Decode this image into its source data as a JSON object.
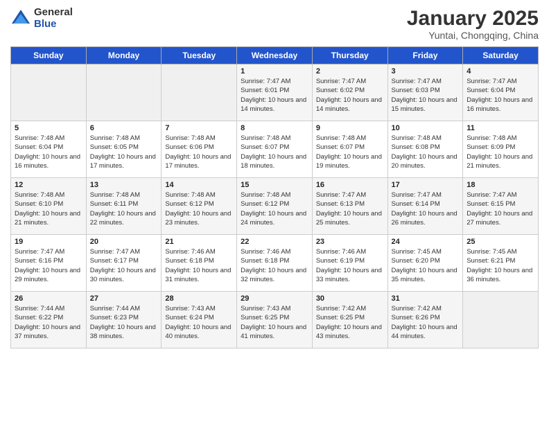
{
  "logo": {
    "general": "General",
    "blue": "Blue"
  },
  "title": "January 2025",
  "subtitle": "Yuntai, Chongqing, China",
  "days_of_week": [
    "Sunday",
    "Monday",
    "Tuesday",
    "Wednesday",
    "Thursday",
    "Friday",
    "Saturday"
  ],
  "weeks": [
    [
      {
        "day": "",
        "info": ""
      },
      {
        "day": "",
        "info": ""
      },
      {
        "day": "",
        "info": ""
      },
      {
        "day": "1",
        "info": "Sunrise: 7:47 AM\nSunset: 6:01 PM\nDaylight: 10 hours and 14 minutes."
      },
      {
        "day": "2",
        "info": "Sunrise: 7:47 AM\nSunset: 6:02 PM\nDaylight: 10 hours and 14 minutes."
      },
      {
        "day": "3",
        "info": "Sunrise: 7:47 AM\nSunset: 6:03 PM\nDaylight: 10 hours and 15 minutes."
      },
      {
        "day": "4",
        "info": "Sunrise: 7:47 AM\nSunset: 6:04 PM\nDaylight: 10 hours and 16 minutes."
      }
    ],
    [
      {
        "day": "5",
        "info": "Sunrise: 7:48 AM\nSunset: 6:04 PM\nDaylight: 10 hours and 16 minutes."
      },
      {
        "day": "6",
        "info": "Sunrise: 7:48 AM\nSunset: 6:05 PM\nDaylight: 10 hours and 17 minutes."
      },
      {
        "day": "7",
        "info": "Sunrise: 7:48 AM\nSunset: 6:06 PM\nDaylight: 10 hours and 17 minutes."
      },
      {
        "day": "8",
        "info": "Sunrise: 7:48 AM\nSunset: 6:07 PM\nDaylight: 10 hours and 18 minutes."
      },
      {
        "day": "9",
        "info": "Sunrise: 7:48 AM\nSunset: 6:07 PM\nDaylight: 10 hours and 19 minutes."
      },
      {
        "day": "10",
        "info": "Sunrise: 7:48 AM\nSunset: 6:08 PM\nDaylight: 10 hours and 20 minutes."
      },
      {
        "day": "11",
        "info": "Sunrise: 7:48 AM\nSunset: 6:09 PM\nDaylight: 10 hours and 21 minutes."
      }
    ],
    [
      {
        "day": "12",
        "info": "Sunrise: 7:48 AM\nSunset: 6:10 PM\nDaylight: 10 hours and 21 minutes."
      },
      {
        "day": "13",
        "info": "Sunrise: 7:48 AM\nSunset: 6:11 PM\nDaylight: 10 hours and 22 minutes."
      },
      {
        "day": "14",
        "info": "Sunrise: 7:48 AM\nSunset: 6:12 PM\nDaylight: 10 hours and 23 minutes."
      },
      {
        "day": "15",
        "info": "Sunrise: 7:48 AM\nSunset: 6:12 PM\nDaylight: 10 hours and 24 minutes."
      },
      {
        "day": "16",
        "info": "Sunrise: 7:47 AM\nSunset: 6:13 PM\nDaylight: 10 hours and 25 minutes."
      },
      {
        "day": "17",
        "info": "Sunrise: 7:47 AM\nSunset: 6:14 PM\nDaylight: 10 hours and 26 minutes."
      },
      {
        "day": "18",
        "info": "Sunrise: 7:47 AM\nSunset: 6:15 PM\nDaylight: 10 hours and 27 minutes."
      }
    ],
    [
      {
        "day": "19",
        "info": "Sunrise: 7:47 AM\nSunset: 6:16 PM\nDaylight: 10 hours and 29 minutes."
      },
      {
        "day": "20",
        "info": "Sunrise: 7:47 AM\nSunset: 6:17 PM\nDaylight: 10 hours and 30 minutes."
      },
      {
        "day": "21",
        "info": "Sunrise: 7:46 AM\nSunset: 6:18 PM\nDaylight: 10 hours and 31 minutes."
      },
      {
        "day": "22",
        "info": "Sunrise: 7:46 AM\nSunset: 6:18 PM\nDaylight: 10 hours and 32 minutes."
      },
      {
        "day": "23",
        "info": "Sunrise: 7:46 AM\nSunset: 6:19 PM\nDaylight: 10 hours and 33 minutes."
      },
      {
        "day": "24",
        "info": "Sunrise: 7:45 AM\nSunset: 6:20 PM\nDaylight: 10 hours and 35 minutes."
      },
      {
        "day": "25",
        "info": "Sunrise: 7:45 AM\nSunset: 6:21 PM\nDaylight: 10 hours and 36 minutes."
      }
    ],
    [
      {
        "day": "26",
        "info": "Sunrise: 7:44 AM\nSunset: 6:22 PM\nDaylight: 10 hours and 37 minutes."
      },
      {
        "day": "27",
        "info": "Sunrise: 7:44 AM\nSunset: 6:23 PM\nDaylight: 10 hours and 38 minutes."
      },
      {
        "day": "28",
        "info": "Sunrise: 7:43 AM\nSunset: 6:24 PM\nDaylight: 10 hours and 40 minutes."
      },
      {
        "day": "29",
        "info": "Sunrise: 7:43 AM\nSunset: 6:25 PM\nDaylight: 10 hours and 41 minutes."
      },
      {
        "day": "30",
        "info": "Sunrise: 7:42 AM\nSunset: 6:25 PM\nDaylight: 10 hours and 43 minutes."
      },
      {
        "day": "31",
        "info": "Sunrise: 7:42 AM\nSunset: 6:26 PM\nDaylight: 10 hours and 44 minutes."
      },
      {
        "day": "",
        "info": ""
      }
    ]
  ]
}
